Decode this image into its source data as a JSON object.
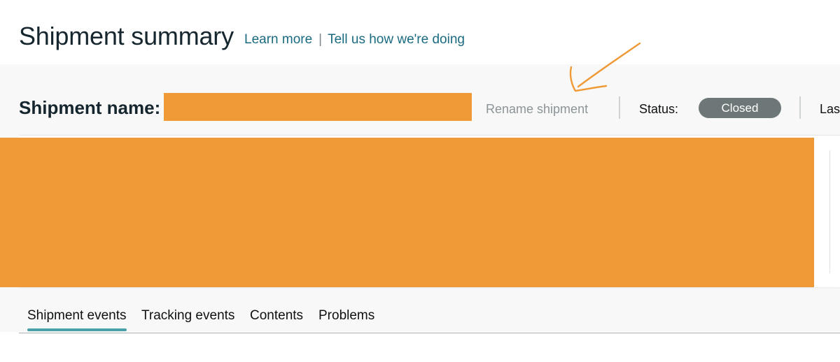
{
  "header": {
    "title": "Shipment summary",
    "learn_more": "Learn more",
    "separator": "|",
    "feedback": "Tell us how we're doing"
  },
  "shipment": {
    "name_label": "Shipment name:",
    "rename_label": "Rename shipment",
    "status_label": "Status:",
    "status_value": "Closed",
    "last_label_partial": "Las"
  },
  "tabs": [
    {
      "label": "Shipment events",
      "active": true
    },
    {
      "label": "Tracking events",
      "active": false
    },
    {
      "label": "Contents",
      "active": false
    },
    {
      "label": "Problems",
      "active": false
    }
  ],
  "colors": {
    "redaction": "#ef9937",
    "link": "#1b6b80",
    "status_pill": "#6e7777",
    "active_tab_underline": "#4aa0a8",
    "annotation_arrow": "#ef9937"
  },
  "icons": {
    "annotation": "hand-drawn-arrow"
  }
}
